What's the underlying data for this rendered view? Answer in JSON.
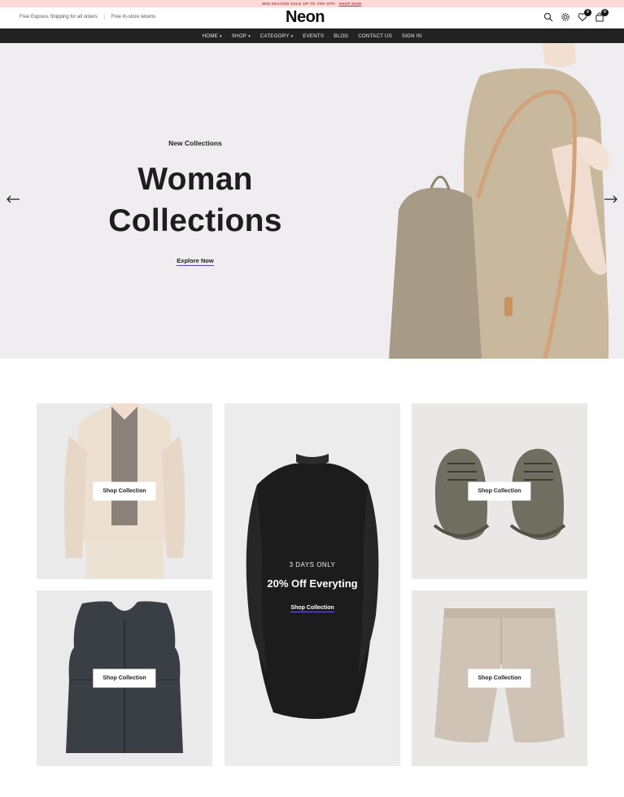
{
  "promo": {
    "text": "MID-SEASON SALE UP TO 70% OFF.",
    "link": "SHOP NOW"
  },
  "header": {
    "shipping_1": "Free Express Shipping for all orders",
    "shipping_2": "Free In-store returns",
    "logo": "Neon",
    "wishlist_count": "0",
    "cart_count": "0",
    "icons": [
      "search-icon",
      "gear-icon",
      "heart-icon",
      "bag-icon"
    ]
  },
  "nav": {
    "items": [
      {
        "label": "HOME",
        "dropdown": true
      },
      {
        "label": "SHOP",
        "dropdown": true
      },
      {
        "label": "CATEGORY",
        "dropdown": true
      },
      {
        "label": "EVENTS",
        "dropdown": false
      },
      {
        "label": "BLOG",
        "dropdown": false
      },
      {
        "label": "CONTACT US",
        "dropdown": false
      },
      {
        "label": "SIGN IN",
        "dropdown": false
      }
    ]
  },
  "hero": {
    "eyebrow": "New Collections",
    "title_line1": "Woman",
    "title_line2": "Collections",
    "cta": "Explore Now"
  },
  "collections": {
    "button_label": "Shop Collection",
    "feature": {
      "days": "3 DAYS ONLY",
      "offer": "20% Off Everyting",
      "link": "Shop Collection"
    }
  },
  "colors": {
    "nav_bg": "#222222",
    "promo_bg": "#fbd9d9",
    "accent": "#5548c8",
    "hero_bg": "#efedef"
  }
}
